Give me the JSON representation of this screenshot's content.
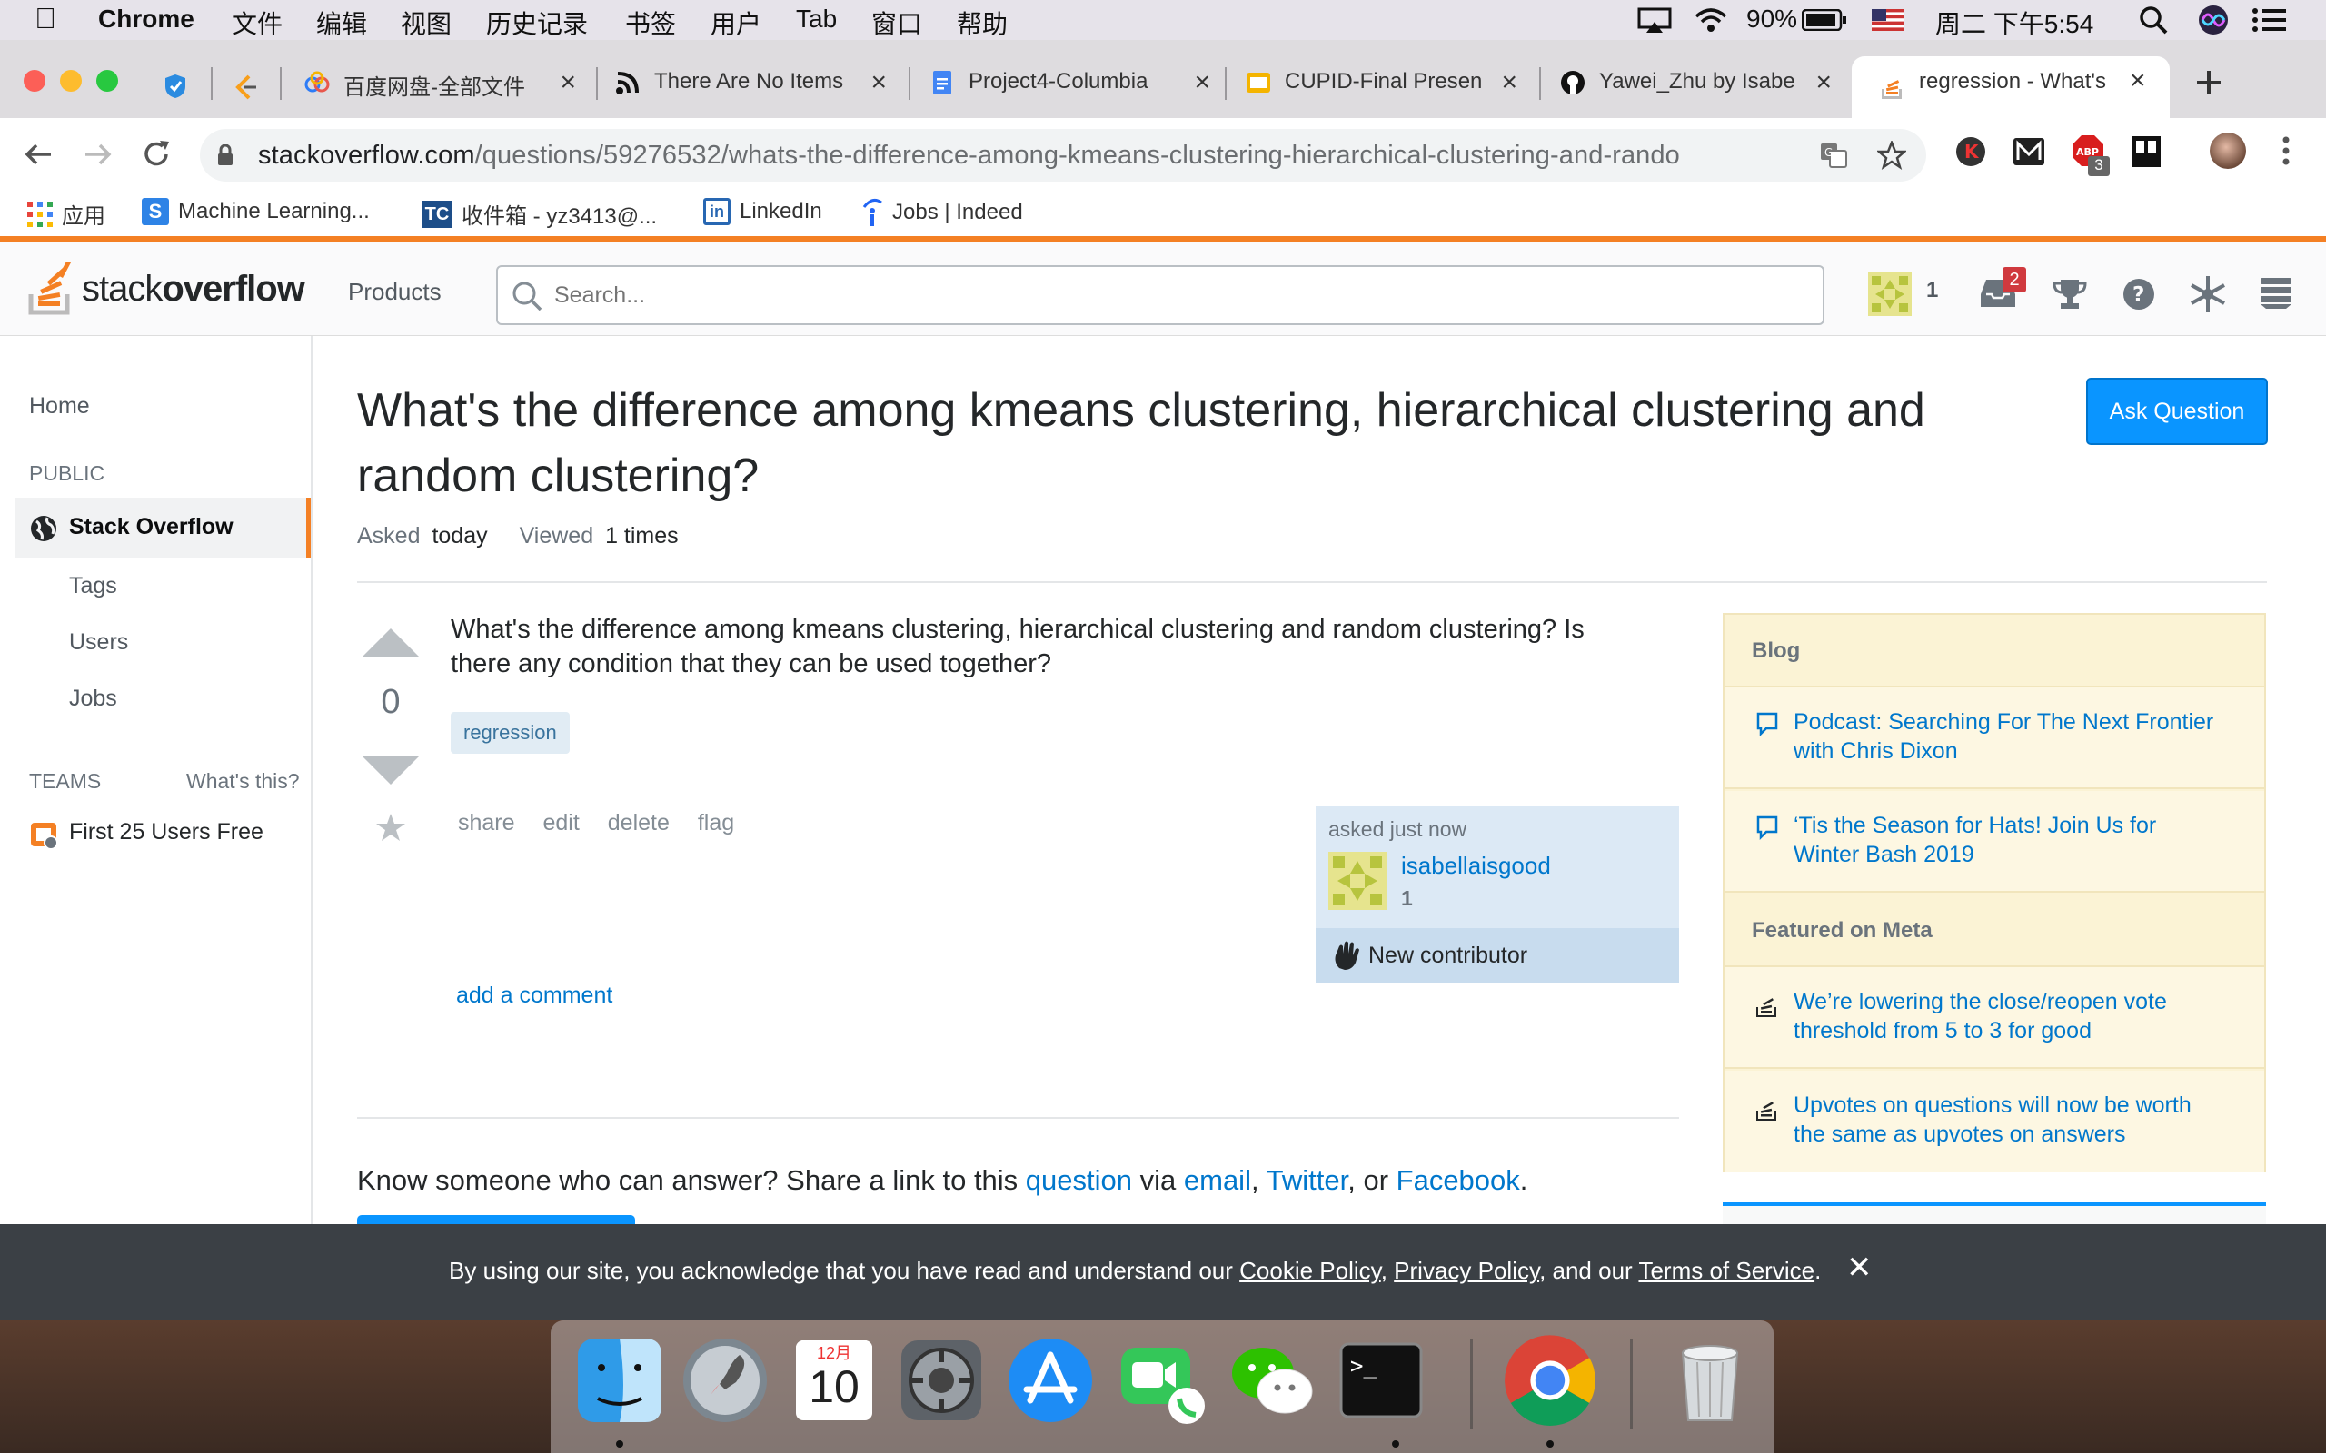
{
  "menubar": {
    "app_name": "Chrome",
    "menus": [
      "文件",
      "编辑",
      "视图",
      "历史记录",
      "书签",
      "用户",
      "Tab",
      "窗口",
      "帮助"
    ],
    "battery": "90%",
    "clock": "周二 下午5:54"
  },
  "tabs": [
    {
      "title": "百度网盘-全部文件"
    },
    {
      "title": "There Are No Items"
    },
    {
      "title": "Project4-Columbia"
    },
    {
      "title": "CUPID-Final Presen"
    },
    {
      "title": "Yawei_Zhu by Isabe"
    },
    {
      "title": "regression - What's"
    }
  ],
  "address": {
    "domain": "stackoverflow.com",
    "path": "/questions/59276532/whats-the-difference-among-kmeans-clustering-hierarchical-clustering-and-rando"
  },
  "extensions": {
    "abp_badge": "3"
  },
  "bookmarks": [
    {
      "label": "应用"
    },
    {
      "label": "Machine Learning..."
    },
    {
      "label": "收件箱 - yz3413@..."
    },
    {
      "label": "LinkedIn"
    },
    {
      "label": "Jobs | Indeed"
    }
  ],
  "so_header": {
    "logo_light": "stack",
    "logo_bold": "overflow",
    "products": "Products",
    "search_placeholder": "Search...",
    "reputation": "1",
    "inbox_badge": "2"
  },
  "leftnav": {
    "home": "Home",
    "public": "PUBLIC",
    "stack_overflow": "Stack Overflow",
    "tags": "Tags",
    "users": "Users",
    "jobs": "Jobs",
    "teams": "TEAMS",
    "whats_this": "What's this?",
    "first25": "First 25 Users Free"
  },
  "question": {
    "title_line1": "What's the difference among kmeans clustering, hierarchical clustering and",
    "title_line2": "random clustering?",
    "ask_button": "Ask Question",
    "asked_label": "Asked",
    "asked_value": "today",
    "viewed_label": "Viewed",
    "viewed_value": "1 times",
    "votes": "0",
    "body_line1": "What's the difference among kmeans clustering, hierarchical clustering and random clustering? Is",
    "body_line2": "there any condition that they can be used together?",
    "tag": "regression",
    "actions": [
      "share",
      "edit",
      "delete",
      "flag"
    ],
    "asked_time": "asked just now",
    "user_name": "isabellaisgood",
    "user_rep": "1",
    "new_contributor": "New contributor",
    "add_comment": "add a comment"
  },
  "share_prompt": {
    "text1": "Know someone who can answer? Share a link to this ",
    "question": "question",
    "via": " via ",
    "email": "email",
    "comma1": ", ",
    "twitter": "Twitter",
    "or": ", or ",
    "facebook": "Facebook",
    "period": "."
  },
  "sidebar": {
    "blog_heading": "Blog",
    "blog_items": [
      {
        "line1": "Podcast: Searching For The Next Frontier",
        "line2": "with Chris Dixon"
      },
      {
        "line1": "‘Tis the Season for Hats! Join Us for",
        "line2": "Winter Bash 2019"
      }
    ],
    "meta_heading": "Featured on Meta",
    "meta_items": [
      {
        "line1": "We’re lowering the close/reopen vote",
        "line2": "threshold from 5 to 3 for good"
      },
      {
        "line1": "Upvotes on questions will now be worth",
        "line2": "the same as upvotes on answers"
      }
    ]
  },
  "cookie": {
    "text1": "By using our site, you acknowledge that you have read and understand our ",
    "cookie_policy": "Cookie Policy",
    "sep1": ", ",
    "privacy_policy": "Privacy Policy",
    "sep2": ", and our ",
    "terms": "Terms of Service",
    "end": ".",
    "close": "✕"
  },
  "dock": {
    "calendar_month": "12月",
    "calendar_day": "10"
  },
  "colors": {
    "so_orange": "#f48024",
    "so_blue": "#0a95ff",
    "link": "#0077cc"
  }
}
